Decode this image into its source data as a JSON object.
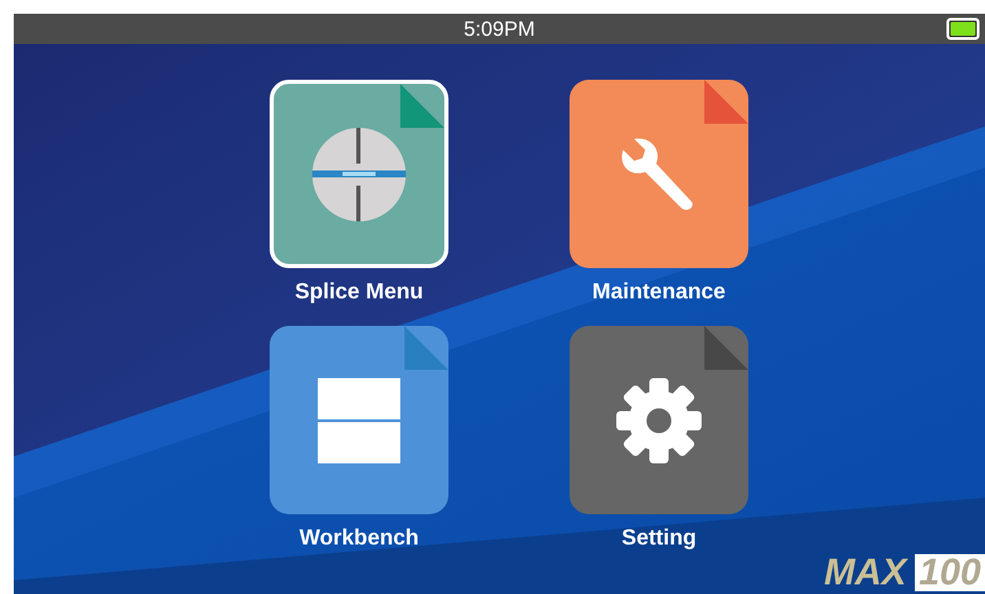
{
  "status_bar": {
    "time": "5:09PM"
  },
  "tiles": [
    {
      "label": "Splice Menu",
      "kind": "splice",
      "color": "#6aaba2",
      "selected": true
    },
    {
      "label": "Maintenance",
      "kind": "wrench",
      "color": "#f28b58",
      "selected": false
    },
    {
      "label": "Workbench",
      "kind": "panels",
      "color": "#4d92d8",
      "selected": false
    },
    {
      "label": "Setting",
      "kind": "gear",
      "color": "#666666",
      "selected": false
    }
  ],
  "logo": {
    "word": "MAX",
    "number": "100"
  }
}
